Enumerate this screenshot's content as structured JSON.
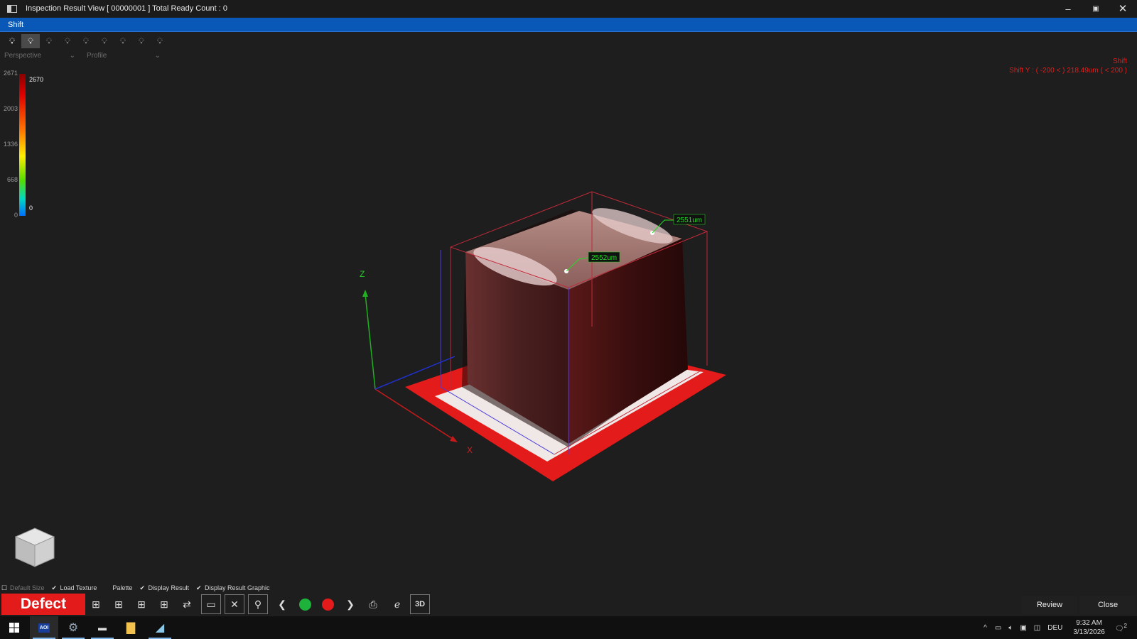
{
  "window": {
    "title": "Inspection Result View [ 00000001 ] Total Ready Count : 0",
    "minimize": "–",
    "restore": "▣",
    "close": "✕"
  },
  "mode_bar": {
    "label": "Shift"
  },
  "light_toolbar": {
    "icons": [
      "bulb-icon",
      "bulb-icon",
      "bulb-h-icon",
      "bulb-icon",
      "bulb-v-icon",
      "bulb-c-icon",
      "bulb-icon",
      "bulb-icon",
      "bulb-icon"
    ],
    "active_index": 1
  },
  "view_select": {
    "value": "Perspective"
  },
  "profile_select": {
    "value": "Profile"
  },
  "height_scale": {
    "ticks": [
      "2671",
      "2003",
      "1336",
      "668",
      "0"
    ],
    "max_label": "2670",
    "min_label": "0"
  },
  "shift_info": {
    "title": "Shift",
    "detail": "Shift Y : ( -200 < ) 218.49um ( < 200 )"
  },
  "scene": {
    "axis_z": "Z",
    "axis_x": "X",
    "measure_front": "2552um",
    "measure_back": "2551um"
  },
  "options": [
    {
      "label": "Default Size",
      "checked": false,
      "enabled": false
    },
    {
      "label": "Load Texture",
      "checked": true,
      "enabled": true
    },
    {
      "label": "Palette",
      "checked": false,
      "enabled": true
    },
    {
      "label": "Display Result",
      "checked": true,
      "enabled": true
    },
    {
      "label": "Display Result Graphic",
      "checked": true,
      "enabled": true
    }
  ],
  "result_badge": "Defect",
  "toolbar": {
    "three_d_label": "3D",
    "review_label": "Review",
    "close_label": "Close",
    "prev_glyph": "❮",
    "next_glyph": "❯",
    "delete_glyph": "✕",
    "pass_color": "#1db33a",
    "fail_color": "#e31b1b"
  },
  "taskbar": {
    "aoi_label": "AOI",
    "language": "DEU",
    "time": "9:32 AM",
    "date": "3/13/2026",
    "notifications": "2"
  },
  "colors": {
    "accent": "#0958b8",
    "defect": "#e31b1b",
    "measure": "#22dd22"
  }
}
